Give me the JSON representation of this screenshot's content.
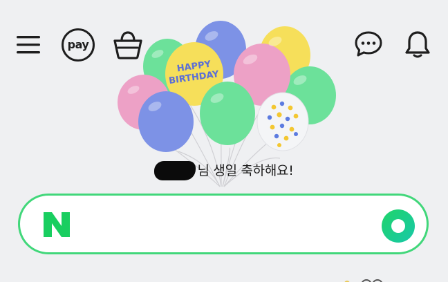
{
  "header": {
    "menu_icon": "hamburger-menu-icon",
    "pay_label": "pay",
    "shopping_icon": "shopping-bag-icon",
    "chat_icon": "chat-bubble-icon",
    "notification_icon": "bell-icon"
  },
  "banner": {
    "balloon_text_line1": "HAPPY",
    "balloon_text_line2": "BIRTHDAY",
    "greeting_suffix": "님 생일 축하해요!"
  },
  "search": {
    "logo_letter": "N",
    "query": "",
    "placeholder": "",
    "lens_icon": "green-lens-icon",
    "accent_color": "#41d77a",
    "logo_color": "#19ce60"
  },
  "colors": {
    "background": "#eff0f2",
    "icon_dark": "#1e1e1e",
    "balloon_blue": "#7d92e6",
    "balloon_yellow": "#f6df5a",
    "balloon_pink": "#eda1c6",
    "balloon_green": "#6ce19a"
  }
}
